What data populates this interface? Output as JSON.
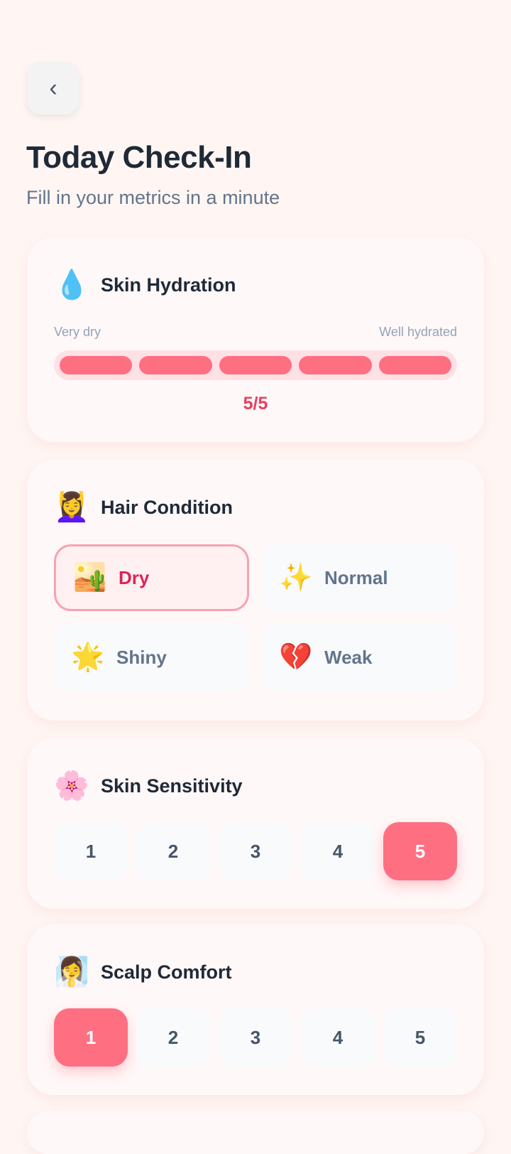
{
  "header": {
    "back_icon": "chevron-left-icon",
    "title": "Today Check-In",
    "subtitle": "Fill in your metrics in a minute"
  },
  "cards": {
    "skin_hydration": {
      "icon": "💧",
      "title": "Skin Hydration",
      "min_label": "Very dry",
      "max_label": "Well hydrated",
      "value": 5,
      "max": 5,
      "value_text": "5/5",
      "fill_fraction": 1.0
    },
    "hair_condition": {
      "icon": "💆‍♀️",
      "title": "Hair Condition",
      "options": [
        {
          "icon": "🏜️",
          "label": "Dry",
          "selected": true
        },
        {
          "icon": "✨",
          "label": "Normal",
          "selected": false
        },
        {
          "icon": "🌟",
          "label": "Shiny",
          "selected": false
        },
        {
          "icon": "💔",
          "label": "Weak",
          "selected": false
        }
      ]
    },
    "skin_sensitivity": {
      "icon": "🌸",
      "title": "Skin Sensitivity",
      "options": [
        "1",
        "2",
        "3",
        "4",
        "5"
      ],
      "selected": "5"
    },
    "scalp_comfort": {
      "icon": "🧖‍♀️",
      "title": "Scalp Comfort",
      "options": [
        "1",
        "2",
        "3",
        "4",
        "5"
      ],
      "selected": "1"
    }
  },
  "colors": {
    "accent": "#ff6f82",
    "accent_text": "#e93f61",
    "background": "#fff6f3",
    "card": "#fff8f8"
  }
}
